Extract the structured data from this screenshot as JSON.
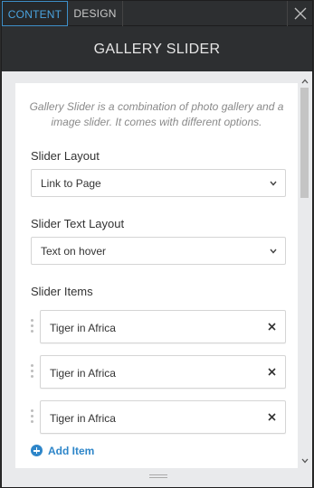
{
  "tabs": {
    "content_label": "CONTENT",
    "design_label": "DESIGN"
  },
  "close_icon": "close-icon",
  "panel": {
    "title": "GALLERY SLIDER"
  },
  "description": "Gallery Slider is a combination of photo gallery and a image slider. It comes with different options.",
  "slider_layout": {
    "label": "Slider Layout",
    "selected": "Link to Page"
  },
  "slider_text_layout": {
    "label": "Slider Text Layout",
    "selected": "Text on hover"
  },
  "slider_items": {
    "label": "Slider Items",
    "items": [
      {
        "label": "Tiger in Africa"
      },
      {
        "label": "Tiger in Africa"
      },
      {
        "label": "Tiger in Africa"
      }
    ],
    "add_label": "Add Item"
  },
  "colors": {
    "accent": "#2e86c9",
    "tab_active": "#4aa3df",
    "header_bg": "#2d2f31",
    "panel_bg": "#e9eaec"
  }
}
